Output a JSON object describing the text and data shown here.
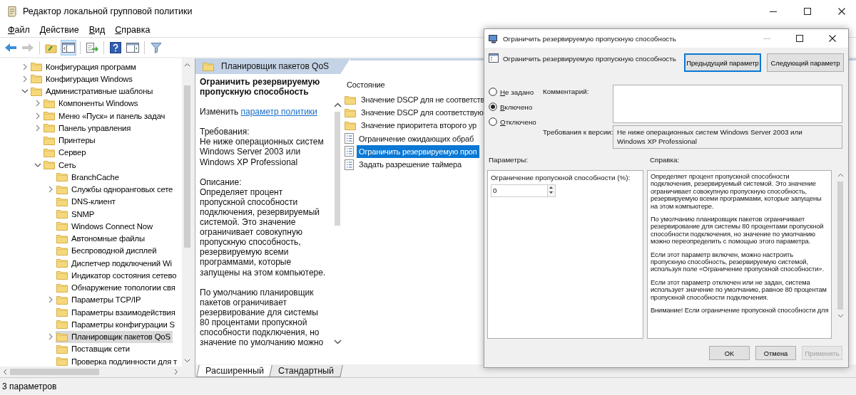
{
  "window": {
    "title": "Редактор локальной групповой политики"
  },
  "menu": [
    "Файл",
    "Действие",
    "Вид",
    "Справка"
  ],
  "toolbar": [
    {
      "kind": "back",
      "disabled": false,
      "pressed": false
    },
    {
      "kind": "forward",
      "disabled": true,
      "pressed": false
    },
    {
      "kind": "up",
      "disabled": false,
      "pressed": false
    },
    {
      "kind": "tree",
      "disabled": false,
      "pressed": true
    },
    {
      "kind": "export",
      "disabled": false,
      "pressed": false
    },
    {
      "kind": "help",
      "disabled": false,
      "pressed": false
    },
    {
      "kind": "view",
      "disabled": false,
      "pressed": false
    },
    {
      "kind": "filter",
      "disabled": false,
      "pressed": false
    }
  ],
  "tree": {
    "items": [
      {
        "label": "Конфигурация программ",
        "expanded": false,
        "selected": false
      },
      {
        "label": "Конфигурация Windows",
        "expanded": false,
        "selected": false
      },
      {
        "label": "Административные шаблоны",
        "expanded": true,
        "selected": false,
        "children": [
          {
            "label": "Компоненты Windows",
            "expanded": false,
            "selected": false
          },
          {
            "label": "Меню «Пуск» и панель задач",
            "expanded": false,
            "selected": false
          },
          {
            "label": "Панель управления",
            "expanded": false,
            "selected": false
          },
          {
            "label": "Принтеры",
            "selected": false
          },
          {
            "label": "Сервер",
            "selected": false
          },
          {
            "label": "Сеть",
            "expanded": true,
            "selected": false,
            "children": [
              {
                "label": "BranchCache",
                "selected": false
              },
              {
                "label": "Службы одноранговых сете",
                "expanded": false,
                "selected": false
              },
              {
                "label": "DNS-клиент",
                "selected": false
              },
              {
                "label": "SNMP",
                "selected": false
              },
              {
                "label": "Windows Connect Now",
                "selected": false
              },
              {
                "label": "Автономные файлы",
                "selected": false
              },
              {
                "label": "Беспроводной дисплей",
                "selected": false
              },
              {
                "label": "Диспетчер подключений Wi",
                "selected": false
              },
              {
                "label": "Индикатор состояния сетево",
                "selected": false
              },
              {
                "label": "Обнаружение топологии свя",
                "selected": false
              },
              {
                "label": "Параметры TCP/IP",
                "expanded": false,
                "selected": false
              },
              {
                "label": "Параметры взаимодействия",
                "selected": false
              },
              {
                "label": "Параметры конфигурации S",
                "selected": false
              },
              {
                "label": "Планировщик пакетов QoS",
                "expanded": false,
                "selected": true
              },
              {
                "label": "Поставщик сети",
                "selected": false
              },
              {
                "label": "Проверка подлинности для т",
                "selected": false
              }
            ]
          }
        ]
      }
    ]
  },
  "details": {
    "header": "Планировщик пакетов QoS",
    "title": "Ограничить резервируемую пропускную способность",
    "edit_prefix": "Изменить",
    "edit_link": "параметр политики",
    "requirements_label": "Требования:",
    "requirements": "Не ниже операционных систем Windows Server 2003 или Windows XP Professional",
    "description_label": "Описание:",
    "paragraphs": [
      "Определяет процент пропускной способности подключения, резервируемый системой. Это значение ограничивает совокупную пропускную способность, резервируемую всеми программами, которые запущены на этом компьютере.",
      "По умолчанию планировщик пакетов ограничивает резервирование для системы 80 процентами пропускной способности подключения, но значение по умолчанию можно"
    ]
  },
  "list": {
    "column": "Состояние",
    "items": [
      {
        "kind": "folder",
        "label": "Значение DSCP для не соответств",
        "selected": false
      },
      {
        "kind": "folder",
        "label": "Значение DSCP для соответствую",
        "selected": false
      },
      {
        "kind": "folder",
        "label": "Значение приоритета второго ур",
        "selected": false
      },
      {
        "kind": "setting",
        "label": "Ограничение ожидающих обраб",
        "selected": false
      },
      {
        "kind": "setting",
        "label": "Ограничить резервируемую проп",
        "selected": true
      },
      {
        "kind": "setting",
        "label": "Задать разрешение таймера",
        "selected": false
      }
    ]
  },
  "view_tabs": [
    {
      "label": "Расширенный",
      "selected": true
    },
    {
      "label": "Стандартный",
      "selected": false
    }
  ],
  "status_bar": "3 параметров",
  "dialog": {
    "title": "Ограничить резервируемую пропускную способность",
    "setting_name": "Ограничить резервируемую пропускную способность",
    "nav_buttons": [
      {
        "label": "Предыдущий параметр",
        "focused": true
      },
      {
        "label": "Следующий параметр",
        "focused": false
      }
    ],
    "options": [
      {
        "label": "Не задано",
        "selected": false
      },
      {
        "label": "Включено",
        "selected": true
      },
      {
        "label": "Отключено",
        "selected": false
      }
    ],
    "comment_label": "Комментарий:",
    "requirements_label": "Требования к версии:",
    "requirements": "Не ниже операционных систем Windows Server 2003 или Windows XP Professional",
    "params_label": "Параметры:",
    "help_label": "Справка:",
    "param": {
      "label": "Ограничение пропускной способности (%):",
      "value": "0"
    },
    "help": [
      "Определяет процент пропускной способности подключения, резервируемый системой. Это значение ограничивает совокупную пропускную способность, резервируемую всеми программами, которые запущены на этом компьютере.",
      "По умолчанию планировщик пакетов ограничивает резервирование для системы 80 процентами пропускной способности подключения, но значение по умолчанию можно переопределить с помощью этого параметра.",
      "Если этот параметр включен, можно настроить пропускную способность, резервируемую системой, используя поле «Ограничение пропускной способности».",
      "Если этот параметр отключен или не задан, система использует значение по умолчанию, равное 80 процентам пропускной способности подключения.",
      "Внимание! Если ограничение пропускной способности для"
    ],
    "buttons": [
      {
        "label": "OK",
        "disabled": false
      },
      {
        "label": "Отмена",
        "disabled": false
      },
      {
        "label": "Применить",
        "disabled": true
      }
    ]
  }
}
